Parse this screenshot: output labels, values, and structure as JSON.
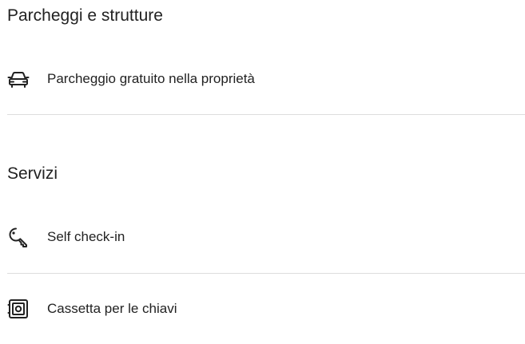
{
  "sections": [
    {
      "title": "Parcheggi e strutture",
      "items": [
        {
          "label": "Parcheggio gratuito nella proprietà",
          "icon": "car-icon"
        }
      ]
    },
    {
      "title": "Servizi",
      "items": [
        {
          "label": "Self check-in",
          "icon": "key-icon"
        },
        {
          "label": "Cassetta per le chiavi",
          "icon": "lockbox-icon"
        }
      ]
    }
  ]
}
